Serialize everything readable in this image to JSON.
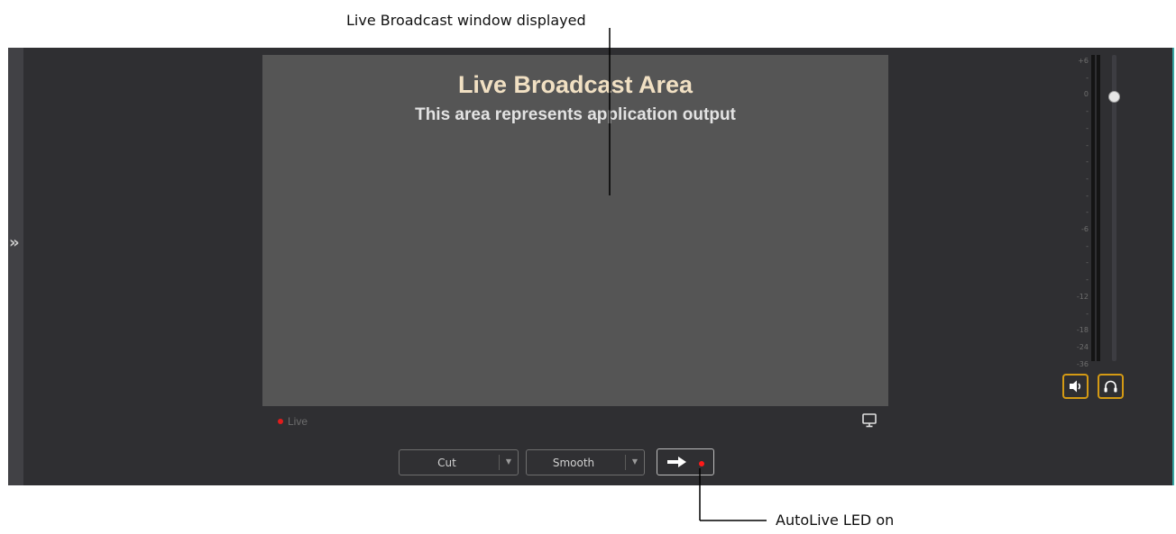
{
  "annotations": {
    "top_callout": "Live Broadcast window displayed",
    "bottom_callout": "AutoLive LED on"
  },
  "preview": {
    "title": "Live Broadcast Area",
    "subtitle": "This area represents application output",
    "live_label": "Live"
  },
  "controls": {
    "transition_value": "Cut",
    "speed_value": "Smooth"
  },
  "audio": {
    "ticks": [
      "+6",
      "-",
      "0",
      "-",
      "-",
      "-",
      "-",
      "-",
      "-",
      "-",
      "-6",
      "-",
      "-",
      "-",
      "-12",
      "-",
      "-18",
      "-24",
      "-36"
    ]
  },
  "colors": {
    "accent": "#d49a14",
    "live_led": "#e21c1c",
    "edge_accent": "#3aa6a3"
  },
  "icons": {
    "expand": "chevron-right-icon",
    "monitor": "monitor-icon",
    "take": "arrow-right-icon",
    "speaker": "speaker-icon",
    "headphones": "headphones-icon"
  }
}
